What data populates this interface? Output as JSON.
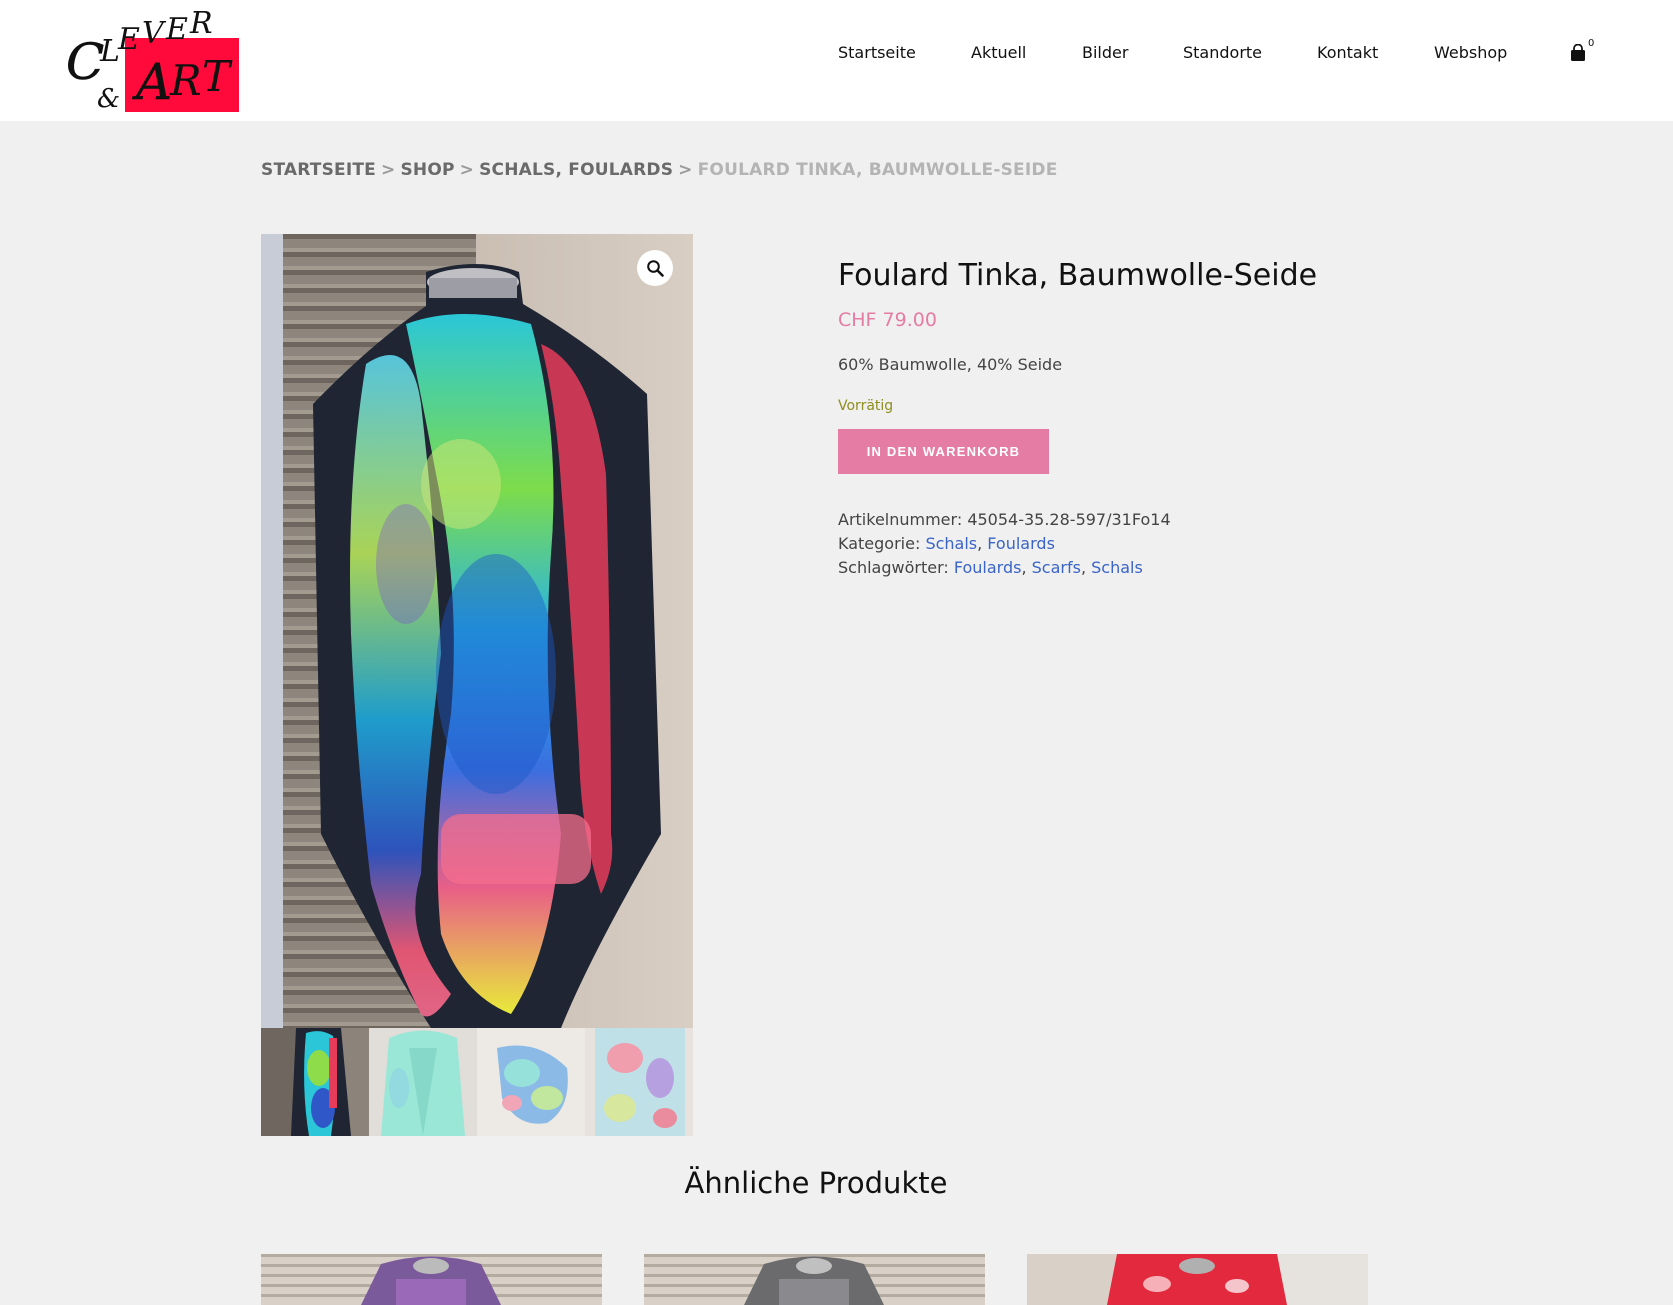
{
  "brand": {
    "logo_text_line1": "CLEVER",
    "logo_text_ampersand": "&",
    "logo_text_line2": "ART",
    "logo_red": "#ff0a3a"
  },
  "nav": {
    "items": [
      {
        "label": "Startseite"
      },
      {
        "label": "Aktuell"
      },
      {
        "label": "Bilder"
      },
      {
        "label": "Standorte"
      },
      {
        "label": "Kontakt"
      },
      {
        "label": "Webshop"
      }
    ],
    "cart_icon": "shopping-bag-icon",
    "cart_count": "0"
  },
  "breadcrumb": {
    "items": [
      "STARTSEITE",
      "SHOP",
      "SCHALS, FOULARDS"
    ],
    "separator": ">",
    "current": "FOULARD TINKA, BAUMWOLLE-SEIDE"
  },
  "product": {
    "title": "Foulard Tinka, Baumwolle-Seide",
    "price": "CHF 79.00",
    "short_description": "60% Baumwolle, 40% Seide",
    "stock": "Vorrätig",
    "add_to_cart_label": "IN DEN WARENKORB",
    "sku_label": "Artikelnummer:",
    "sku": "45054-35.28-597/31Fo14",
    "category_label": "Kategorie:",
    "categories": [
      "Schals",
      "Foulards"
    ],
    "tags_label": "Schlagwörter:",
    "tags": [
      "Foulards",
      "Scarfs",
      "Schals"
    ],
    "zoom_icon": "magnifier-icon",
    "thumbnails": 4
  },
  "related": {
    "title": "Ähnliche Produkte",
    "count": 3
  },
  "colors": {
    "accent_pink": "#e47ca4",
    "link_blue": "#3a64c8",
    "stock_olive": "#8f8e1f",
    "page_bg": "#f0f0f0"
  }
}
